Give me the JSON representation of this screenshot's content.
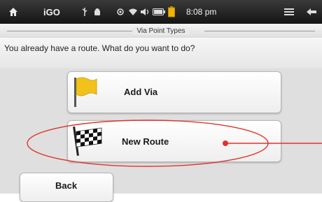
{
  "status_bar": {
    "home_icon": "home-icon",
    "app_name": "iGO",
    "time": "8:08 pm"
  },
  "title_bar": {
    "title": "Via Point Types"
  },
  "prompt": "You already have a route. What do you want to do?",
  "options": [
    {
      "label": "Add Via",
      "icon": "yellow-flag-icon"
    },
    {
      "label": "New Route",
      "icon": "checkered-flag-icon"
    }
  ],
  "back_button": {
    "label": "Back"
  },
  "colors": {
    "highlight_ellipse": "#e2332b",
    "status_bar_bg": "#1f1f1f",
    "flag_yellow": "#f2c21a"
  }
}
